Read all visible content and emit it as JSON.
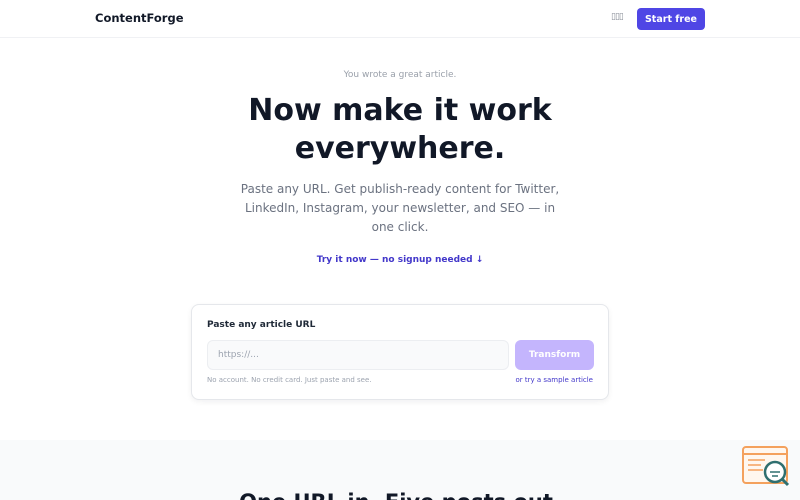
{
  "nav": {
    "brand": "ContentForge",
    "language_glyph": "▯▯▯",
    "start_label": "Start free"
  },
  "hero": {
    "eyebrow": "You wrote a great article.",
    "headline_line1": "Now make it work",
    "headline_line2": "everywhere.",
    "subhead": "Paste any URL. Get publish-ready content for Twitter, LinkedIn, Instagram, your newsletter, and SEO — in one click.",
    "try_link": "Try it now — no signup needed ↓"
  },
  "form": {
    "label": "Paste any article URL",
    "input_placeholder": "https://...",
    "input_value": "",
    "submit_label": "Transform",
    "note": "No account. No credit card. Just paste and see.",
    "sample_link": "or try a sample article"
  },
  "next_section": {
    "title": "One URL in. Five posts out."
  },
  "colors": {
    "accent": "#4f46e5",
    "accent_disabled": "#c4b5fd",
    "link": "#4338ca",
    "widget_orange": "#f4a15d",
    "widget_teal": "#2f6f6f"
  },
  "icons": {
    "floating_widget": "search-document-icon"
  }
}
